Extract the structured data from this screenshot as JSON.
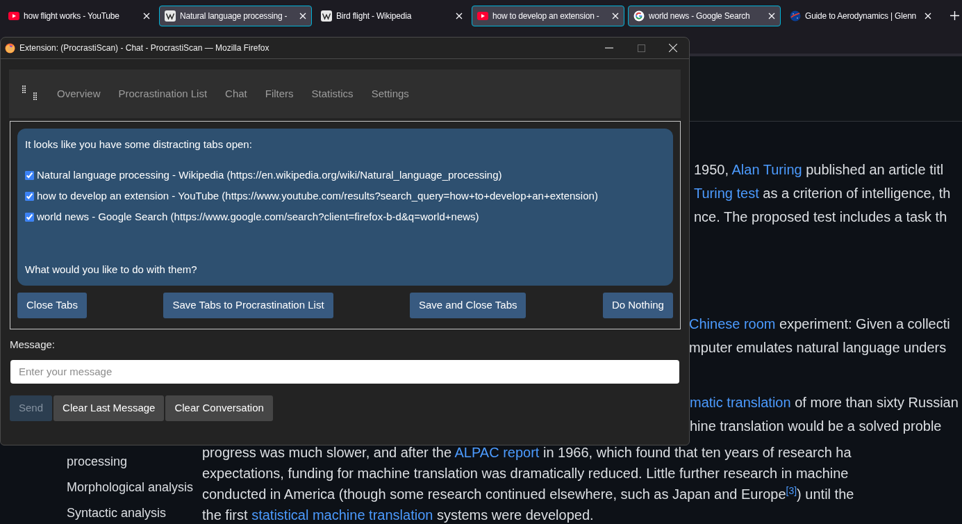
{
  "browser": {
    "tabs": [
      {
        "title": "how flight works - YouTube",
        "kind": "youtube",
        "selected": false
      },
      {
        "title": "Natural language processing -",
        "kind": "wikipedia",
        "selected": true
      },
      {
        "title": "Bird flight - Wikipedia",
        "kind": "wikipedia",
        "selected": false
      },
      {
        "title": "how to develop an extension -",
        "kind": "youtube",
        "selected": true
      },
      {
        "title": "world news - Google Search",
        "kind": "google",
        "selected": true
      },
      {
        "title": "Guide to Aerodynamics | Glenn",
        "kind": "nasa",
        "selected": false
      }
    ]
  },
  "article": {
    "upper_lines": [
      [
        {
          "kind": "text",
          "text": "1950, "
        },
        {
          "kind": "link",
          "text": "Alan Turing"
        },
        {
          "kind": "text",
          "text": " published an article titl"
        }
      ],
      [
        {
          "kind": "link",
          "text": "Turing test"
        },
        {
          "kind": "text",
          "text": " as a criterion of intelligence, th"
        }
      ],
      [
        {
          "kind": "text",
          "text": "nce. The proposed test includes a task th"
        }
      ]
    ],
    "middle_lines": [
      [
        {
          "kind": "link",
          "text": "Chinese room"
        },
        {
          "kind": "text",
          "text": " experiment: Given a collecti"
        }
      ],
      [
        {
          "kind": "text",
          "text": "mputer emulates natural language unders"
        }
      ]
    ],
    "side_lines": [
      [
        {
          "kind": "link",
          "text": "matic translation"
        },
        {
          "kind": "text",
          "text": " of more than sixty Russian"
        }
      ],
      [
        {
          "kind": "text",
          "text": "hine translation would be a solved proble"
        }
      ]
    ],
    "lower_lines": [
      [
        {
          "kind": "text",
          "text": "progress was much slower, and after the "
        },
        {
          "kind": "link",
          "text": "ALPAC report"
        },
        {
          "kind": "text",
          "text": " in 1966, which found that ten years of research ha"
        }
      ],
      [
        {
          "kind": "text",
          "text": "expectations, funding for machine translation was dramatically reduced. Little further research in machine"
        }
      ],
      [
        {
          "kind": "text",
          "text": "conducted in America (though some research continued elsewhere, such as Japan and Europe"
        },
        {
          "kind": "ref",
          "text": "[3]"
        },
        {
          "kind": "text",
          "text": ") until the"
        }
      ],
      [
        {
          "kind": "text",
          "text": "the first "
        },
        {
          "kind": "link",
          "text": "statistical machine translation"
        },
        {
          "kind": "text",
          "text": " systems were developed."
        }
      ]
    ]
  },
  "sidebar": {
    "items": [
      "processing",
      "Morphological analysis",
      "Syntactic analysis"
    ]
  },
  "popup": {
    "title": "Extension: (ProcrastiScan) - Chat - ProcrastiScan — Mozilla Firefox",
    "nav": [
      "Overview",
      "Procrastination List",
      "Chat",
      "Filters",
      "Statistics",
      "Settings"
    ],
    "intro": "It looks like you have some distracting tabs open:",
    "distracting_tabs": [
      {
        "label": "Natural language processing - Wikipedia (https://en.wikipedia.org/wiki/Natural_language_processing)",
        "checked": true
      },
      {
        "label": "how to develop an extension - YouTube (https://www.youtube.com/results?search_query=how+to+develop+an+extension)",
        "checked": true
      },
      {
        "label": "world news - Google Search (https://www.google.com/search?client=firefox-b-d&q=world+news)",
        "checked": true
      }
    ],
    "question": "What would you like to do with them?",
    "actions": [
      "Close Tabs",
      "Save Tabs to Procrastination List",
      "Save and Close Tabs",
      "Do Nothing"
    ],
    "message_label": "Message:",
    "message_placeholder": "Enter your message",
    "buttons": [
      {
        "label": "Send",
        "disabled": true
      },
      {
        "label": "Clear Last Message",
        "disabled": false
      },
      {
        "label": "Clear Conversation",
        "disabled": false
      }
    ]
  }
}
